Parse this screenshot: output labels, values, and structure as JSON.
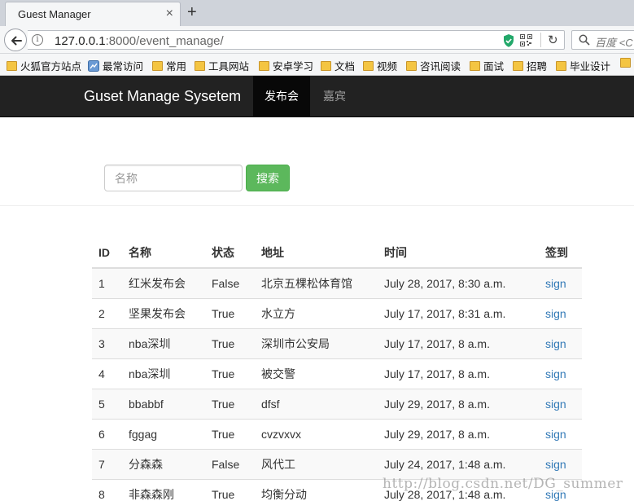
{
  "browser": {
    "tab_title": "Guest Manager",
    "tab_close": "×",
    "new_tab": "+",
    "url_host": "127.0.0.1",
    "url_rest": ":8000/event_manage/",
    "search_placeholder": "百度 <C",
    "bookmarks": [
      "火狐官方站点",
      "最常访问",
      "常用",
      "工具网站",
      "安卓学习",
      "文档",
      "视频",
      "咨讯阅读",
      "面试",
      "招聘",
      "毕业设计"
    ]
  },
  "app": {
    "brand": "Guset Manage Sysetem",
    "nav": [
      {
        "label": "发布会",
        "active": true
      },
      {
        "label": "嘉宾",
        "active": false
      }
    ],
    "search": {
      "placeholder": "名称",
      "button": "搜索"
    }
  },
  "table": {
    "headers": [
      "ID",
      "名称",
      "状态",
      "地址",
      "时间",
      "签到"
    ],
    "rows": [
      [
        "1",
        "红米发布会",
        "False",
        "北京五棵松体育馆",
        "July 28, 2017, 8:30 a.m.",
        "sign"
      ],
      [
        "2",
        "坚果发布会",
        "True",
        "水立方",
        "July 17, 2017, 8:31 a.m.",
        "sign"
      ],
      [
        "3",
        "nba深圳",
        "True",
        "深圳市公安局",
        "July 17, 2017, 8 a.m.",
        "sign"
      ],
      [
        "4",
        "nba深圳",
        "True",
        "被交警",
        "July 17, 2017, 8 a.m.",
        "sign"
      ],
      [
        "5",
        "bbabbf",
        "True",
        "dfsf",
        "July 29, 2017, 8 a.m.",
        "sign"
      ],
      [
        "6",
        "fggag",
        "True",
        "cvzvxvx",
        "July 29, 2017, 8 a.m.",
        "sign"
      ],
      [
        "7",
        "分森森",
        "False",
        "风代工",
        "July 24, 2017, 1:48 a.m.",
        "sign"
      ],
      [
        "8",
        "非森森刚",
        "True",
        "均衡分动",
        "July 28, 2017, 1:48 a.m.",
        "sign"
      ]
    ]
  },
  "watermark": "http://blog.csdn.net/DG_summer"
}
